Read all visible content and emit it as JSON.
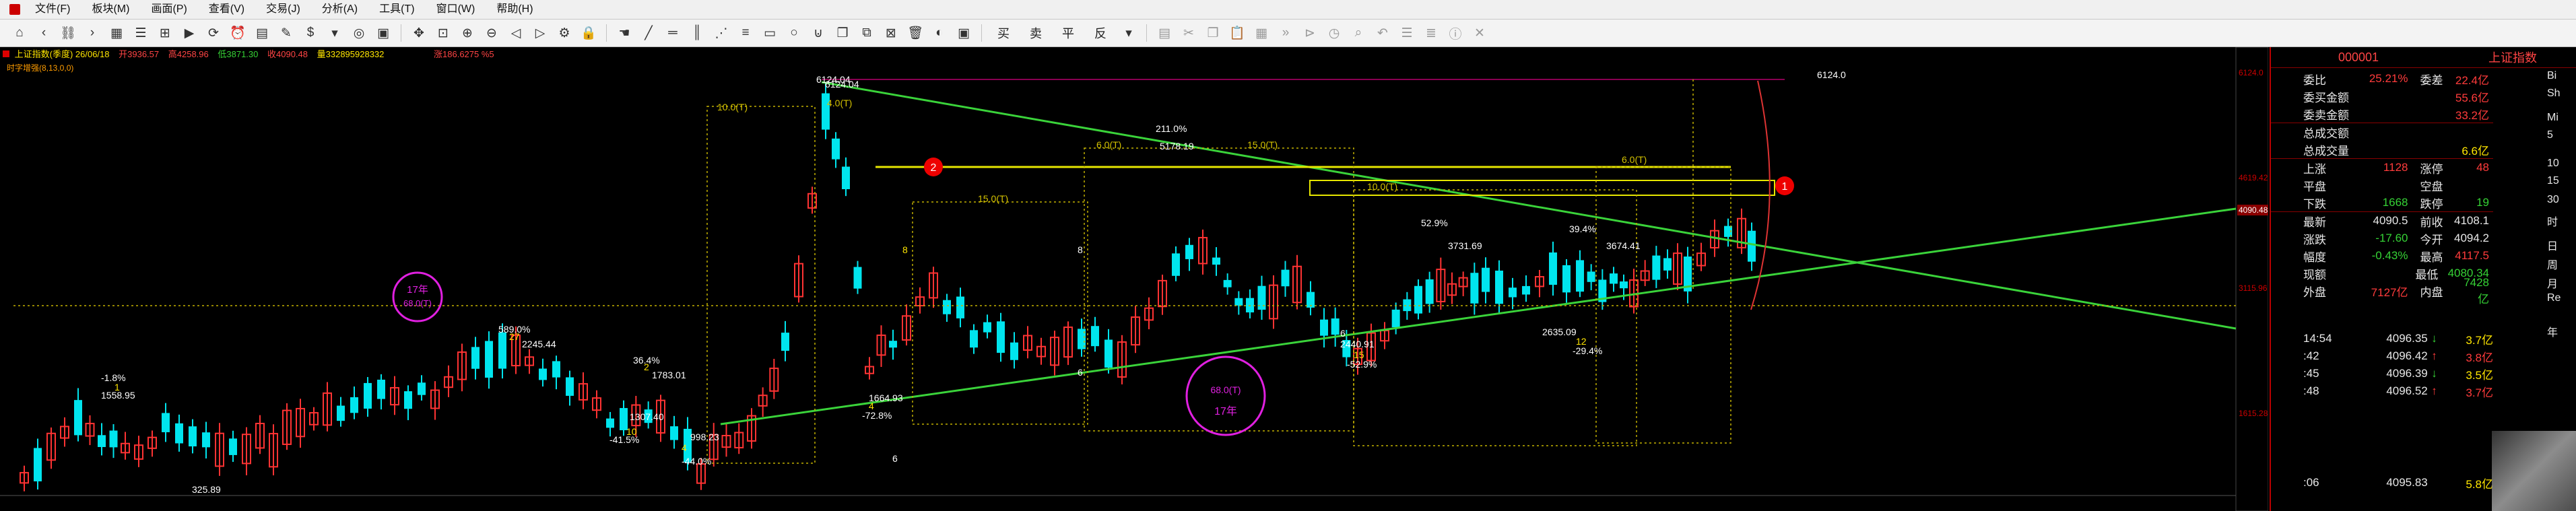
{
  "menubar": {
    "items": [
      "文件(F)",
      "板块(M)",
      "画面(P)",
      "查看(V)",
      "交易(J)",
      "分析(A)",
      "工具(T)",
      "窗口(W)",
      "帮助(H)"
    ]
  },
  "toolbar": {
    "order_labels": [
      "买",
      "卖",
      "平",
      "反"
    ]
  },
  "chart": {
    "header": {
      "title": "上证指数(季度) 26/06/18",
      "open": "开3936.57",
      "high": "高4258.96",
      "low": "低3871.30",
      "close": "收4090.48",
      "volume": "量332895928332",
      "change": "涨186.6275 %5"
    },
    "indicator": "时字增强(8,13,0,0)",
    "markers": {
      "circle1": "1",
      "circle2": "2"
    },
    "annotations": [
      {
        "t": "1558.95",
        "c": "#ffffff"
      },
      {
        "t": "-1.8%",
        "c": "#ffffff"
      },
      {
        "t": "1",
        "c": "#ffe600"
      },
      {
        "t": "325.89",
        "c": "#ffffff"
      },
      {
        "t": "589.0%",
        "c": "#ffffff"
      },
      {
        "t": "2245.44",
        "c": "#ffffff"
      },
      {
        "t": "27",
        "c": "#ffe600"
      },
      {
        "t": "36.4%",
        "c": "#ffffff"
      },
      {
        "t": "1783.01",
        "c": "#ffffff"
      },
      {
        "t": "2",
        "c": "#ffe600"
      },
      {
        "t": "1307.40",
        "c": "#ffffff"
      },
      {
        "t": "10",
        "c": "#ffe600"
      },
      {
        "t": "-41.5%",
        "c": "#ffffff"
      },
      {
        "t": "998.23",
        "c": "#ffffff"
      },
      {
        "t": "4",
        "c": "#ffe600"
      },
      {
        "t": "-44.0%",
        "c": "#ffffff"
      },
      {
        "t": "6124.04",
        "c": "#ffffff"
      },
      {
        "t": "6124.04",
        "c": "#ffffff"
      },
      {
        "t": "1664.93",
        "c": "#ffffff"
      },
      {
        "t": "-72.8%",
        "c": "#ffffff"
      },
      {
        "t": "4",
        "c": "#ffe600"
      },
      {
        "t": "211.0%",
        "c": "#ffffff"
      },
      {
        "t": "5178.19",
        "c": "#ffffff"
      },
      {
        "t": "2440.91",
        "c": "#ffffff"
      },
      {
        "t": "15",
        "c": "#ffe600"
      },
      {
        "t": "-52.9%",
        "c": "#ffffff"
      },
      {
        "t": "52.9%",
        "c": "#ffffff"
      },
      {
        "t": "3731.69",
        "c": "#ffffff"
      },
      {
        "t": "39.4%",
        "c": "#ffffff"
      },
      {
        "t": "3674.41",
        "c": "#ffffff"
      },
      {
        "t": "2635.09",
        "c": "#ffffff"
      },
      {
        "t": "12",
        "c": "#ffe600"
      },
      {
        "t": "-29.4%",
        "c": "#ffffff"
      },
      {
        "t": "6124.0",
        "c": "#ffffff"
      },
      {
        "t": "10.0(T)",
        "c": "#d4c200"
      },
      {
        "t": "4.0(T)",
        "c": "#d4c200"
      },
      {
        "t": "15.0(T)",
        "c": "#d4c200"
      },
      {
        "t": "6.0(T)",
        "c": "#d4c200"
      },
      {
        "t": "15.0(T)",
        "c": "#d4c200"
      },
      {
        "t": "10.0(T)",
        "c": "#d4c200"
      },
      {
        "t": "6.0(T)",
        "c": "#d4c200"
      },
      {
        "t": "8",
        "c": "#ffe600"
      },
      {
        "t": "6",
        "c": "#ffffff"
      },
      {
        "t": "8",
        "c": "#ffffff"
      },
      {
        "t": "6",
        "c": "#ffffff"
      },
      {
        "t": "6",
        "c": "#ffffff"
      },
      {
        "t": "4",
        "c": "#ffffff"
      }
    ],
    "circle_a": {
      "top": "17年",
      "bottom": "68.0(T)"
    },
    "circle_b": {
      "top": "68.0(T)",
      "bottom": "17年"
    },
    "price_tags": [
      "6124.0",
      "4619.42",
      "4090.48",
      "3115.96",
      "1615.28"
    ]
  },
  "quote": {
    "code": "000001",
    "name": "上证指数",
    "rows": [
      {
        "l": "委比",
        "v": "25.21%",
        "vc": "red",
        "l2": "委差",
        "v2": "22.4亿",
        "v2c": "red"
      },
      {
        "l": "委买金额",
        "v": "",
        "vc": "white",
        "l2": "",
        "v2": "55.6亿",
        "v2c": "red"
      },
      {
        "l": "委卖金额",
        "v": "",
        "vc": "white",
        "l2": "",
        "v2": "33.2亿",
        "v2c": "red"
      },
      {
        "l": "总成交额",
        "v": "",
        "vc": "white",
        "l2": "",
        "v2": "",
        "v2c": "white"
      },
      {
        "l": "总成交量",
        "v": "",
        "vc": "white",
        "l2": "",
        "v2": "6.6亿",
        "v2c": "yellow"
      },
      {
        "l": "上涨",
        "v": "1128",
        "vc": "red",
        "l2": "涨停",
        "v2": "48",
        "v2c": "red"
      },
      {
        "l": "平盘",
        "v": "",
        "vc": "white",
        "l2": "空盘",
        "v2": "",
        "v2c": "white"
      },
      {
        "l": "下跌",
        "v": "1668",
        "vc": "green",
        "l2": "跌停",
        "v2": "19",
        "v2c": "green"
      },
      {
        "l": "最新",
        "v": "4090.5",
        "vc": "white",
        "l2": "前收",
        "v2": "4108.1",
        "v2c": "white"
      },
      {
        "l": "涨跌",
        "v": "-17.60",
        "vc": "green",
        "l2": "今开",
        "v2": "4094.2",
        "v2c": "white"
      },
      {
        "l": "幅度",
        "v": "-0.43%",
        "vc": "green",
        "l2": "最高",
        "v2": "4117.5",
        "v2c": "red"
      },
      {
        "l": "现额",
        "v": "",
        "vc": "white",
        "l2": "最低",
        "v2": "4080.34",
        "v2c": "green"
      },
      {
        "l": "外盘",
        "v": "7127亿",
        "vc": "red",
        "l2": "内盘",
        "v2": "7428亿",
        "v2c": "green"
      }
    ],
    "ticks": [
      {
        "t": "14:54",
        "p": "4096.35",
        "a": "↓",
        "ac": "green",
        "q": "3.7亿",
        "qc": "yellow"
      },
      {
        "t": ":42",
        "p": "4096.42",
        "a": "↑",
        "ac": "red",
        "q": "3.8亿",
        "qc": "red"
      },
      {
        "t": ":45",
        "p": "4096.39",
        "a": "↓",
        "ac": "green",
        "q": "3.5亿",
        "qc": "yellow"
      },
      {
        "t": ":48",
        "p": "4096.52",
        "a": "↑",
        "ac": "red",
        "q": "3.7亿",
        "qc": "red"
      },
      {
        "t": ":06",
        "p": "4095.83",
        "a": "",
        "ac": "white",
        "q": "5.8亿",
        "qc": "yellow"
      }
    ],
    "side_chars": [
      "Bi",
      "Sh",
      "Mi",
      "5",
      "10",
      "15",
      "30",
      "时",
      "日",
      "周",
      "月",
      "Re",
      "年"
    ]
  }
}
